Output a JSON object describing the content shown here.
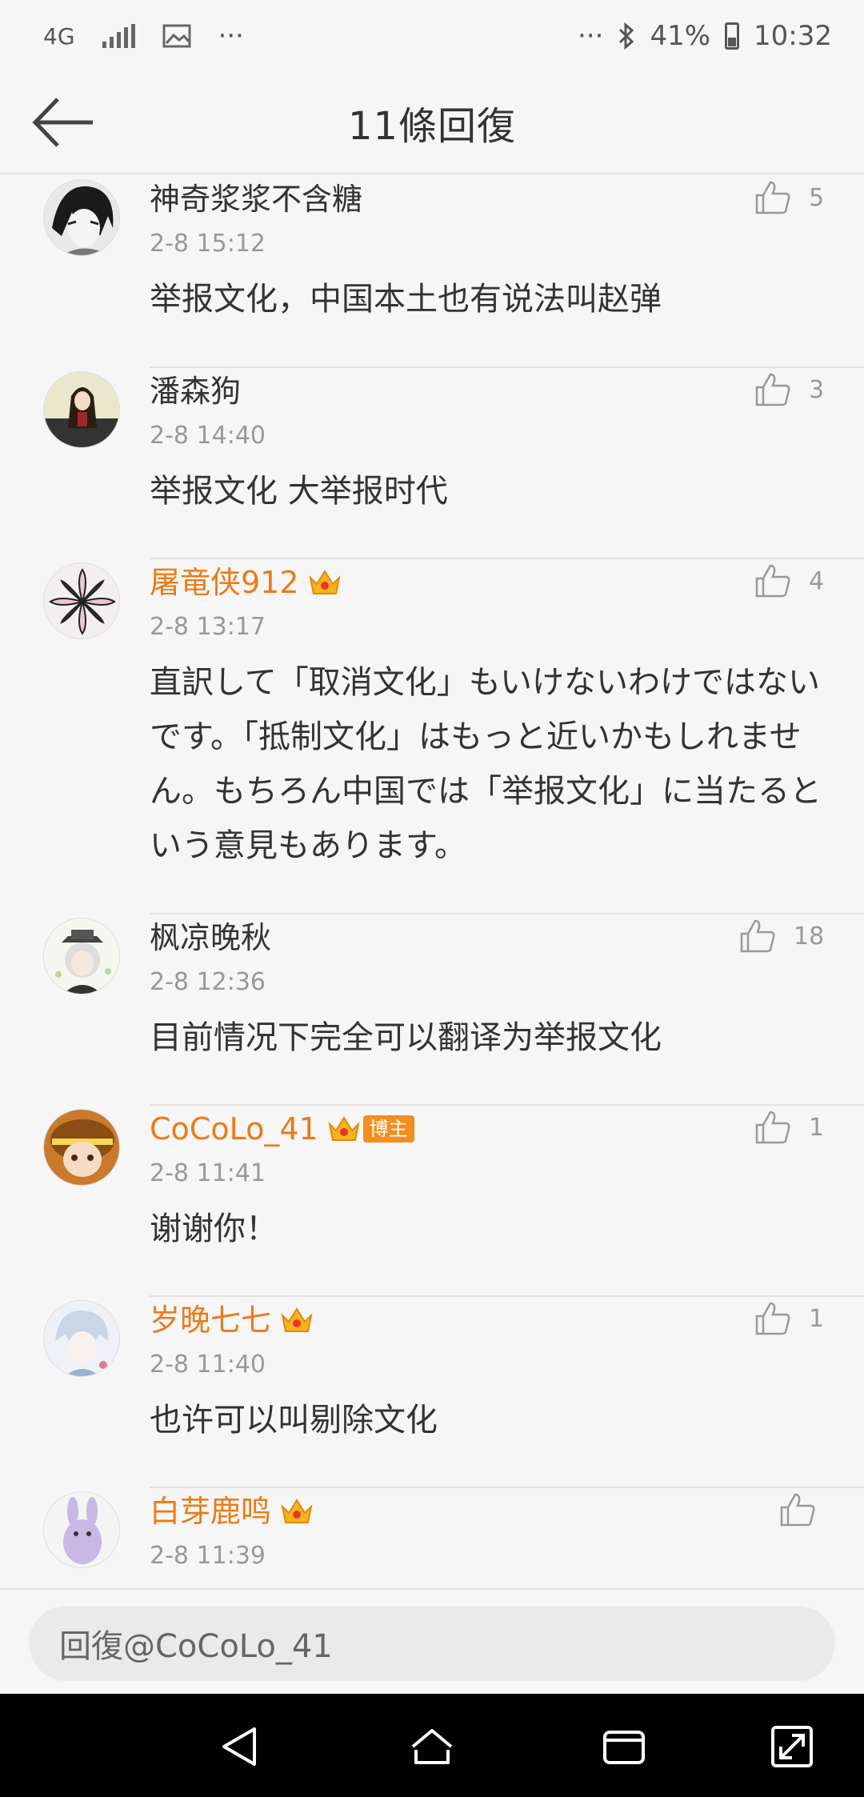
{
  "status_bar": {
    "network": "4G",
    "more": "···",
    "more_right": "···",
    "battery": "41%",
    "time": "10:32"
  },
  "header": {
    "title": "11條回復"
  },
  "comments": [
    {
      "name": "神奇浆浆不含糖",
      "time": "2-8 15:12",
      "text": "举报文化，中国本土也有说法叫赵弹",
      "likes": "5",
      "highlight": false
    },
    {
      "name": "潘森狗",
      "time": "2-8 14:40",
      "text": "举报文化 大举报时代",
      "likes": "3",
      "highlight": false
    },
    {
      "name": "屠竜侠912",
      "time": "2-8 13:17",
      "text": "直訳して「取消文化」もいけないわけではないです。「抵制文化」はもっと近いかもしれません。もちろん中国では「举报文化」に当たるという意見もあります。",
      "likes": "4",
      "highlight": true
    },
    {
      "name": "枫凉晚秋",
      "time": "2-8 12:36",
      "text": "目前情况下完全可以翻译为举报文化",
      "likes": "18",
      "highlight": false
    },
    {
      "name": "CoCoLo_41",
      "time": "2-8 11:41",
      "text": "谢谢你！",
      "likes": "1",
      "highlight": true,
      "badge": "博主"
    },
    {
      "name": "岁晚七七",
      "time": "2-8 11:40",
      "text": "也许可以叫剔除文化",
      "likes": "1",
      "highlight": true
    },
    {
      "name": "白芽鹿鸣",
      "time": "2-8 11:39",
      "text": "",
      "likes": "",
      "highlight": true
    }
  ],
  "reply": {
    "placeholder": "回復@CoCoLo_41"
  },
  "colors": {
    "accent": "#eb7b16",
    "badge": "#f48e1e"
  }
}
